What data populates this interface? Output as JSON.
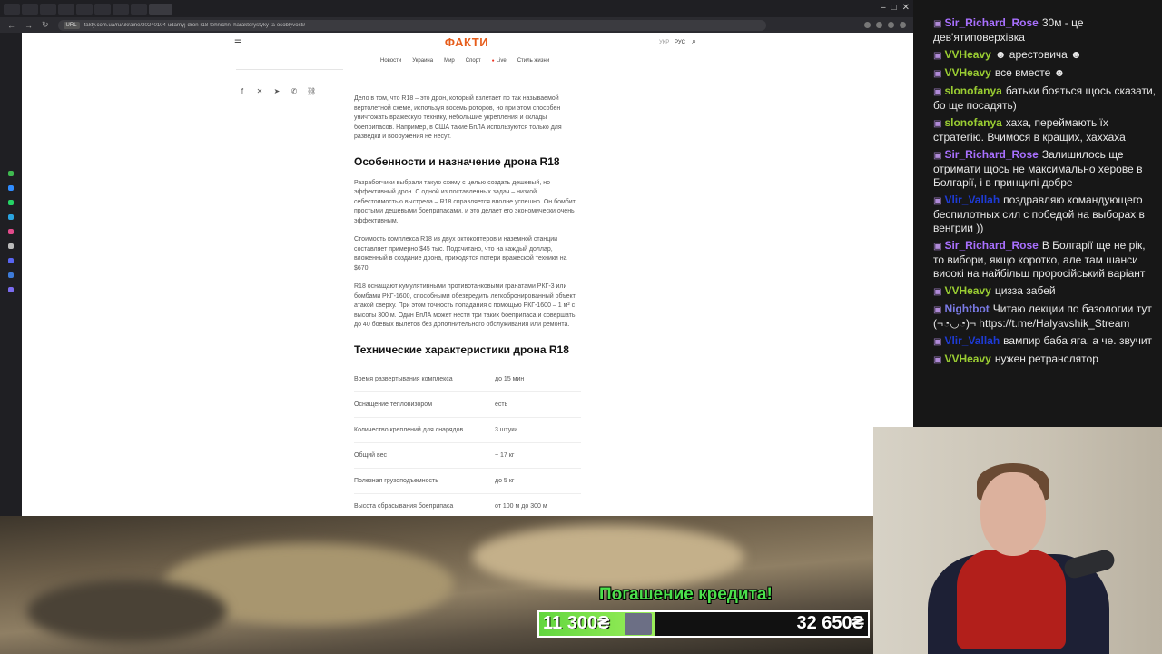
{
  "browser": {
    "url": "fakty.com.ua/ru/ukraine/20240104-udarnyj-dron-r18-tehnichni-harakterystyky-ta-osoblyvosti/",
    "url_badge": "URL"
  },
  "site": {
    "logo": "ФАКТИ",
    "lang_ukr": "УКР",
    "lang_rus": "РУС",
    "nav": [
      "Новости",
      "Украина",
      "Мир",
      "Спорт",
      "Live",
      "Стиль жизни"
    ]
  },
  "article": {
    "intro": "Дело в том, что R18 – это дрон, который взлетает по так называемой вертолетной схеме, используя восемь роторов, но при этом способен уничтожать вражескую технику, небольшие укрепления и склады боеприпасов. Например, в США такие БпЛА используются только для разведки и вооружения не несут.",
    "section1_title": "Особенности и назначение дрона R18",
    "section1_p1": "Разработчики выбрали такую схему с целью создать дешевый, но эффективный дрон. С одной из поставленных задач – низкой себестоимостью выстрела – R18 справляется вполне успешно. Он бомбит простыми дешевыми боеприпасами, и это делает его экономически очень эффективным.",
    "section1_p2": "Стоимость комплекса R18 из двух октокоптеров и наземной станции составляет примерно $45 тыс. Подсчитано, что на каждый доллар, вложенный в создание дрона, приходятся потери вражеской техники на $670.",
    "section1_p3": "R18 оснащают кумулятивными противотанковыми гранатами РКГ-3 или бомбами РКГ-1600, способными обезвредить легкобронированный объект атакой сверху. При этом точность попадания с помощью РКГ-1600 – 1 м² с высоты 300 м. Один БпЛА может нести три таких боеприпаса и совершать до 40 боевых вылетов без дополнительного обслуживания или ремонта.",
    "section2_title": "Технические характеристики дрона R18",
    "specs": [
      {
        "k": "Время развертывания комплекса",
        "v": "до 15 мин"
      },
      {
        "k": "Оснащение тепловизором",
        "v": "есть"
      },
      {
        "k": "Количество креплений для снарядов",
        "v": "3 штуки"
      },
      {
        "k": "Общий вес",
        "v": "~ 17 кг"
      },
      {
        "k": "Полезная грузоподъемность",
        "v": "до 5 кг"
      },
      {
        "k": "Высота сбрасывания боеприпаса",
        "v": "от 100 м до 300 м"
      }
    ]
  },
  "chat": {
    "messages": [
      {
        "user": "Sir_Richard_Rose",
        "color": "#a970ff",
        "text": "30м - це дев'ятиповерхівка"
      },
      {
        "user": "VVHeavy",
        "color": "#9acd32",
        "text": "☻ арестовича ☻"
      },
      {
        "user": "VVHeavy",
        "color": "#9acd32",
        "text": "все вместе ☻"
      },
      {
        "user": "slonofanya",
        "color": "#9acd32",
        "text": "батьки бояться щось сказати, бо ще посадять)"
      },
      {
        "user": "slonofanya",
        "color": "#9acd32",
        "text": "хаха, переймають їх стратегію. Вчимося в кращих, хаххаха"
      },
      {
        "user": "Sir_Richard_Rose",
        "color": "#a970ff",
        "text": "Залишилось ще отримати щось не максимально херове в Болгарії, і в принципі добре"
      },
      {
        "user": "Vlir_Vallah",
        "color": "#1e3bd6",
        "text": "поздравляю командующего беспилотных сил с победой на выборах в венгрии ))"
      },
      {
        "user": "Sir_Richard_Rose",
        "color": "#a970ff",
        "text": "В Болгарії ще не рік, то вибори, якщо коротко, але там шанси високі на найбільш проросійський варіант"
      },
      {
        "user": "VVHeavy",
        "color": "#9acd32",
        "text": "цизза забей"
      },
      {
        "user": "Nightbot",
        "color": "#7a7ae6",
        "text": "Читаю лекции по базологии тут (¬◔◡◔)¬ https://t.me/Halyavshik_Stream"
      },
      {
        "user": "Vlir_Vallah",
        "color": "#1e3bd6",
        "text": "вампир баба яга. а че. звучит"
      },
      {
        "user": "VVHeavy",
        "color": "#9acd32",
        "text": "нужен ретранслятор"
      }
    ]
  },
  "donation": {
    "title": "Погашение кредита!",
    "current": "11 300₴",
    "goal": "32 650₴",
    "progress": 0.35
  }
}
